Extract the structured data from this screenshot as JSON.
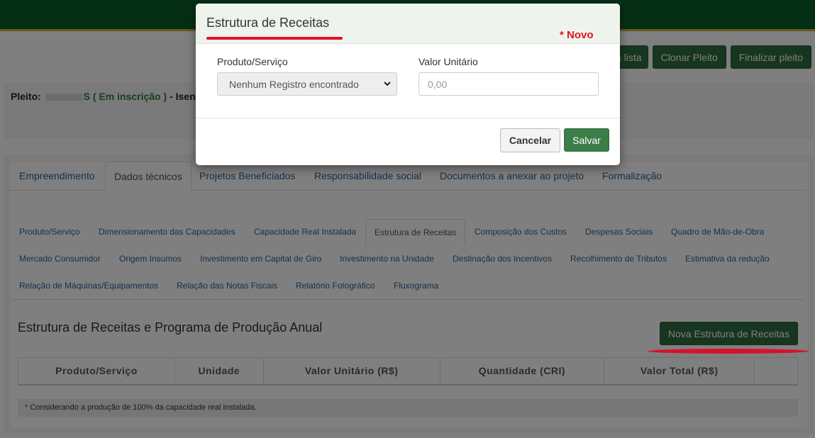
{
  "top_actions": {
    "partial_label": "a lista",
    "clone_label": "Clonar Pleito",
    "finalize_label": "Finalizar pleito"
  },
  "pleito": {
    "prefix": "Pleito:",
    "id_fragment": "S",
    "status": "( Em inscrição )",
    "suffix": "- Isençã"
  },
  "tabs": [
    {
      "label": "Empreendimento",
      "active": false
    },
    {
      "label": "Dados técnicos",
      "active": true
    },
    {
      "label": "Projetos Beneficiados",
      "active": false
    },
    {
      "label": "Responsabilidade social",
      "active": false
    },
    {
      "label": "Documentos a anexar ao projeto",
      "active": false
    },
    {
      "label": "Formalização",
      "active": false
    }
  ],
  "subtabs": [
    {
      "label": "Produto/Serviço"
    },
    {
      "label": "Dimensionamento das Capacidades"
    },
    {
      "label": "Capacidade Real Instalada"
    },
    {
      "label": "Estrutura de Receitas",
      "active": true
    },
    {
      "label": "Composição dos Custos"
    },
    {
      "label": "Despesas Sociais"
    },
    {
      "label": "Quadro de Mão-de-Obra"
    },
    {
      "label": "Mercado Consumidor"
    },
    {
      "label": "Origem Insumos"
    },
    {
      "label": "Investimento em Capital de Giro"
    },
    {
      "label": "Investimento na Unidade"
    },
    {
      "label": "Destinação dos Incentivos"
    },
    {
      "label": "Recolhimento de Tributos"
    },
    {
      "label": "Estimativa da redução"
    },
    {
      "label": "Relação de Máquinas/Equipamentos"
    },
    {
      "label": "Relação das Notas Fiscais"
    },
    {
      "label": "Relatório Fotográfico"
    },
    {
      "label": "Fluxograma"
    }
  ],
  "section": {
    "title": "Estrutura de Receitas e Programa de Produção Anual",
    "new_button": "Nova Estrutura de Receitas"
  },
  "table": {
    "columns": [
      "Produto/Serviço",
      "Unidade",
      "Valor Unitário (R$)",
      "Quantidade (CRI)",
      "Valor Total (R$)",
      ""
    ]
  },
  "footnote": {
    "marker": "*",
    "text": "Considerando a produção de 100% da capacidade real instalada."
  },
  "modal": {
    "title": "Estrutura de Receitas",
    "novo": "* Novo",
    "produto_label": "Produto/Serviço",
    "produto_selected": "Nenhum Registro encontrado",
    "valor_label": "Valor Unitário",
    "valor_placeholder": "0,00",
    "cancel": "Cancelar",
    "save": "Salvar"
  },
  "colors": {
    "topbar": "#0b5f2b",
    "accent_green": "#2f6c3e",
    "link_blue": "#2a6396",
    "annotation_red": "#e2112a"
  },
  "icons": {
    "select_caret": "chevron-down-icon"
  }
}
